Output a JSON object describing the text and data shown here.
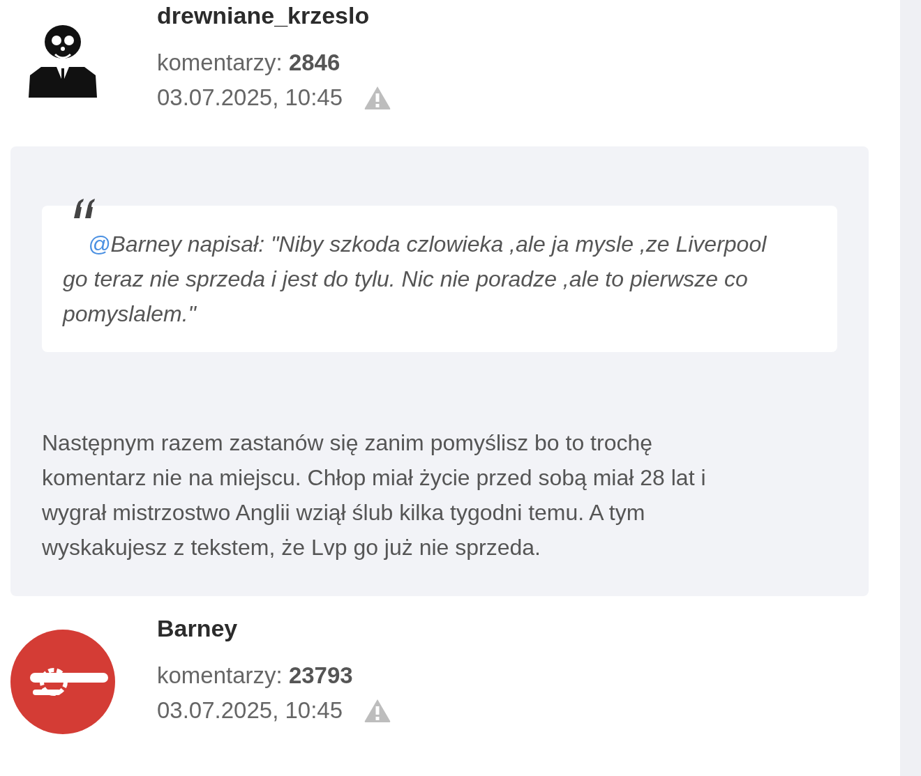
{
  "comments": [
    {
      "author": "drewniane_krzeslo",
      "avatar": {
        "kind": "figure"
      },
      "count_label": "komentarzy:",
      "count": "2846",
      "date": "03.07.2025, 10:45",
      "quote": {
        "mention": "@",
        "text": "Barney napisał: \"Niby szkoda czlowieka ,ale ja mysle ,ze Liverpool go teraz nie sprzeda i jest do tylu. Nic nie poradze ,ale to pierwsze co pomyslalem.\""
      },
      "body": "Następnym razem zastanów się zanim pomyślisz bo to trochę komentarz nie na miejscu. Chłop miał życie przed sobą miał 28 lat i wygrał mistrzostwo Anglii wziął ślub kilka tygodni temu. A tym wyskakujesz z tekstem, że Lvp go już nie sprzeda."
    },
    {
      "author": "Barney",
      "avatar": {
        "kind": "cannon"
      },
      "count_label": "komentarzy:",
      "count": "23793",
      "date": "03.07.2025, 10:45"
    }
  ]
}
